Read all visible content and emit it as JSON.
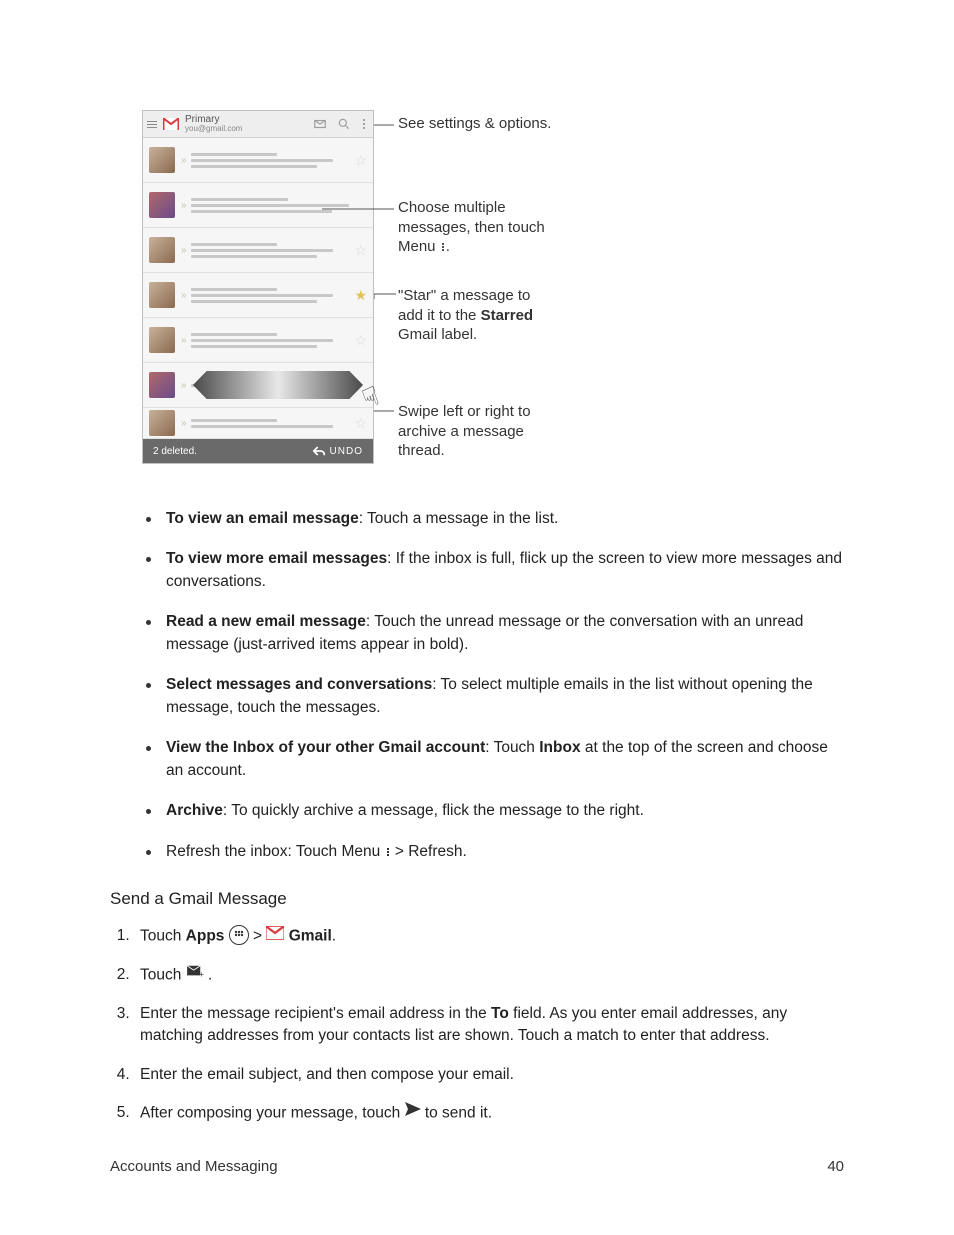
{
  "phone": {
    "header_title": "Primary",
    "header_subtitle": "you@gmail.com",
    "snackbar_text": "2 deleted.",
    "snackbar_action": "UNDO"
  },
  "annotations": {
    "a1": "See settings & options.",
    "a2_line1": "Choose multiple messages, then touch Menu ",
    "a2_line2": ".",
    "a3_line1": "\"Star\" a message to add it to the ",
    "a3_bold": "Starred",
    "a3_line2": " Gmail label.",
    "a4": "Swipe left or right to archive a message thread."
  },
  "bullets": {
    "b1_bold": "To view an email message",
    "b1_rest": ": Touch a message in the list.",
    "b2_bold": "To view more email messages",
    "b2_rest": ": If the inbox is full, flick up the screen to view more messages and conversations.",
    "b3_bold": "Read a new email message",
    "b3_rest": ": Touch the unread message or the conversation with an unread message (just-arrived items appear in bold).",
    "b4_bold": "Select messages and conversations",
    "b4_rest": ": To select multiple emails in the list without opening the message, touch the messages.",
    "b5_bold": "View the Inbox of your other Gmail account",
    "b5_rest_a": ": Touch ",
    "b5_inbox": "Inbox",
    "b5_rest_b": " at the top of the screen and choose an account.",
    "b6_bold": "Archive",
    "b6_rest": ": To quickly archive a message, flick the message to the right.",
    "b7_a": "Refresh the inbox: Touch Menu ",
    "b7_b": " > Refresh."
  },
  "section_heading": "Send a Gmail Message",
  "steps": {
    "s1_a": "Touch ",
    "s1_apps": "Apps",
    "s1_b": " > ",
    "s1_gmail": " Gmail",
    "s1_c": ".",
    "s2_a": "Touch ",
    "s2_b": ".",
    "s3_a": "Enter the message recipient's email address in the ",
    "s3_to": "To",
    "s3_b": " field. As you enter email addresses, any matching addresses from your contacts list are shown. Touch a match to enter that address.",
    "s4": "Enter the email subject, and then compose your email.",
    "s5_a": "After composing your message, touch ",
    "s5_b": " to send it."
  },
  "footer": {
    "left": "Accounts and Messaging",
    "right": "40"
  }
}
